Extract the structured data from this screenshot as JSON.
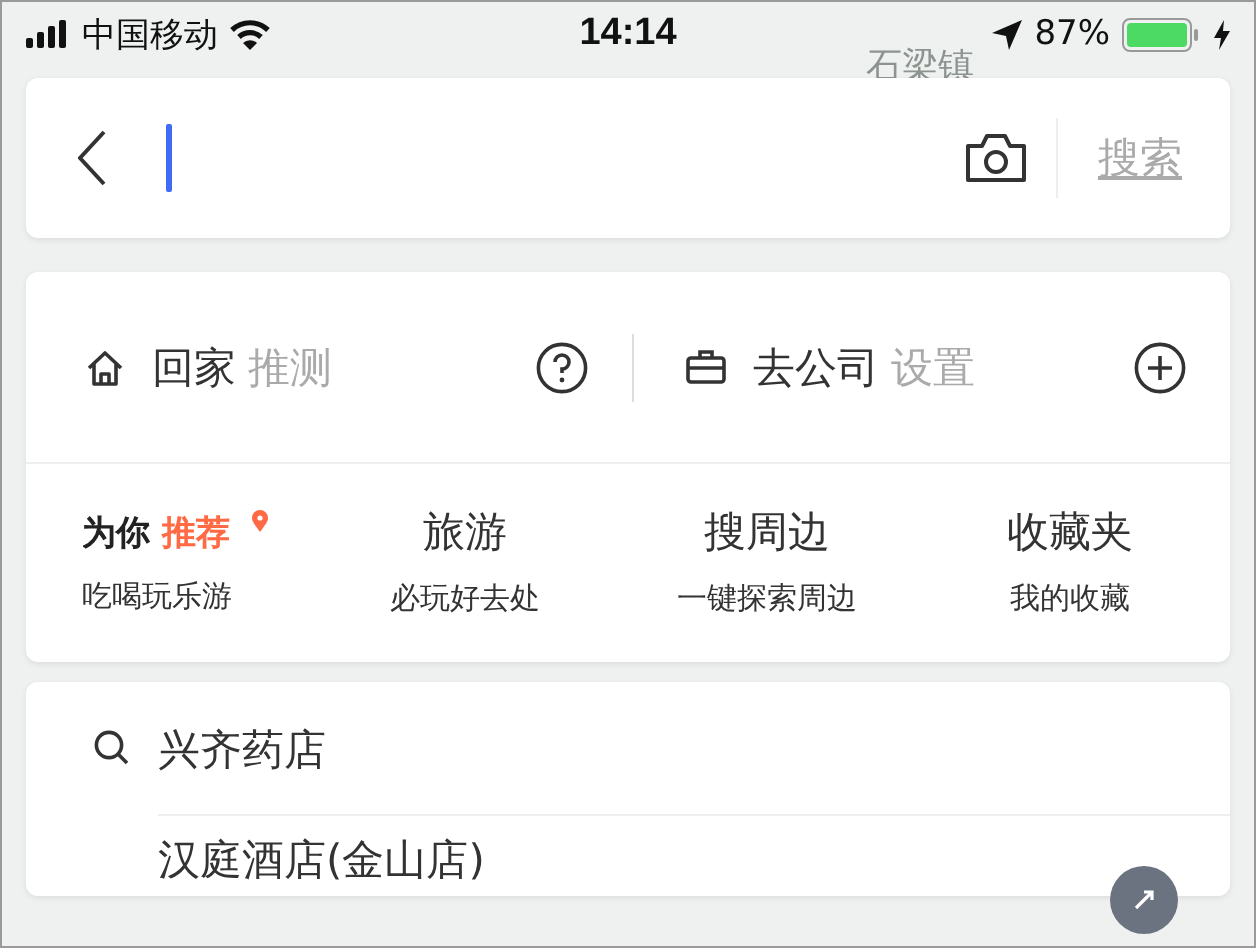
{
  "status_bar": {
    "carrier": "中国移动",
    "time": "14:14",
    "battery": "87%",
    "charging": true
  },
  "map_labels": [
    "石梁镇"
  ],
  "search_bar": {
    "cursor": true,
    "search_button": "搜索"
  },
  "shortcuts": [
    {
      "kind": "home",
      "label": "回家",
      "action": "推测"
    },
    {
      "kind": "work",
      "label": "去公司",
      "action": "设置"
    }
  ],
  "categories": [
    {
      "title": "为你",
      "highlight": "推荐",
      "subtitle": "吃喝玩乐游"
    },
    {
      "title": "旅游",
      "subtitle": "必玩好去处"
    },
    {
      "title": "搜周边",
      "subtitle": "一键探索周边"
    },
    {
      "title": "收藏夹",
      "subtitle": "我的收藏"
    }
  ],
  "history": [
    {
      "kind": "query",
      "text": "兴齐药店"
    },
    {
      "kind": "place",
      "text": "汉庭酒店(金山店)"
    }
  ]
}
